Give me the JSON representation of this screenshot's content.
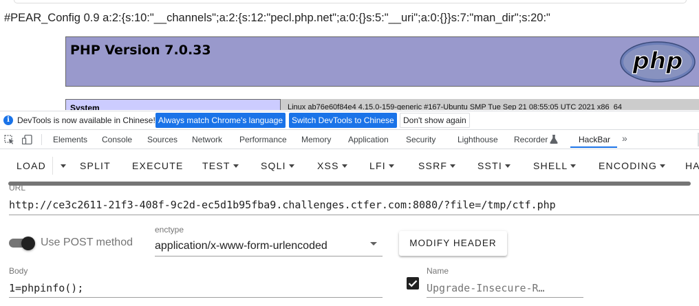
{
  "page": {
    "pear_config_text": "#PEAR_Config 0.9 a:2:{s:10:\"__channels\";a:2:{s:12:\"pecl.php.net\";a:0:{}s:5:\"__uri\";a:0:{}}s:7:\"man_dir\";s:20:\"",
    "php_version": "PHP Version 7.0.33",
    "logo_text": "php",
    "system_label": "System",
    "system_value": "Linux ab76e60f84e4 4.15.0-159-generic #167-Ubuntu SMP Tue Sep 21 08:55:05 UTC 2021 x86_64"
  },
  "infobar": {
    "icon": "info-icon",
    "message": "DevTools is now available in Chinese!",
    "buttons": [
      "Always match Chrome's language",
      "Switch DevTools to Chinese",
      "Don't show again"
    ]
  },
  "devtools": {
    "icons": [
      "inspect-element-icon",
      "device-toolbar-icon"
    ],
    "tabs": [
      "Elements",
      "Console",
      "Sources",
      "Network",
      "Performance",
      "Memory",
      "Application",
      "Security",
      "Lighthouse",
      "Recorder",
      "HackBar"
    ],
    "active_tab": "HackBar",
    "more_icon": "»"
  },
  "hackbar": {
    "toolbar": [
      "LOAD",
      "SPLIT",
      "EXECUTE",
      "TEST",
      "SQLI",
      "XSS",
      "LFI",
      "SSRF",
      "SSTI",
      "SHELL",
      "ENCODING",
      "HA"
    ],
    "url_label": "URL",
    "url_value": "http://ce3c2611-21f3-408f-9c2d-ec5d1b95fba9.challenges.ctfer.com:8080/?file=/tmp/ctf.php",
    "post_toggle_label": "Use POST method",
    "post_enabled": true,
    "enctype_label": "enctype",
    "enctype_value": "application/x-www-form-urlencoded",
    "modify_header_label": "MODIFY HEADER",
    "body_label": "Body",
    "body_value": "1=phpinfo();",
    "header_name_label": "Name",
    "header_name_value": "Upgrade-Insecure-R…",
    "header_checked": true
  },
  "colors": {
    "php_header_bg": "#9999cc",
    "system_row_bg": "#ccccff",
    "accent_blue": "#1a73e8"
  }
}
